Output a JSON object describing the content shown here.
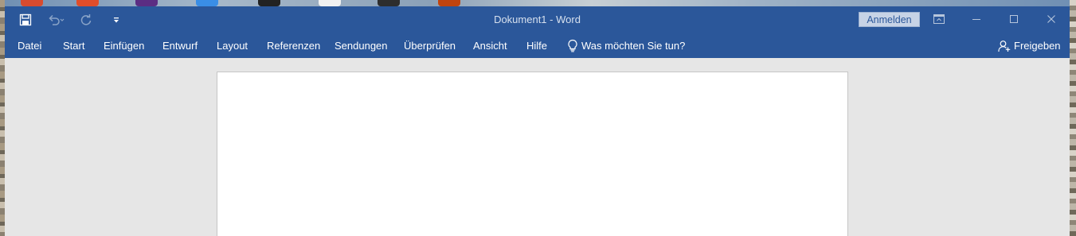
{
  "window": {
    "title": "Dokument1  -  Word"
  },
  "quick_access": {
    "save_icon": "save-icon",
    "undo_icon": "undo-icon",
    "redo_icon": "redo-icon",
    "customize_icon": "customize-qat-icon"
  },
  "account": {
    "signin_label": "Anmelden"
  },
  "menu": {
    "items": [
      {
        "label": "Datei"
      },
      {
        "label": "Start"
      },
      {
        "label": "Einfügen"
      },
      {
        "label": "Entwurf"
      },
      {
        "label": "Layout"
      },
      {
        "label": "Referenzen"
      },
      {
        "label": "Sendungen"
      },
      {
        "label": "Überprüfen"
      },
      {
        "label": "Ansicht"
      },
      {
        "label": "Hilfe"
      }
    ],
    "tell_me": "Was möchten Sie tun?",
    "share": "Freigeben"
  },
  "colors": {
    "brand": "#2b579a",
    "workspace": "#e6e6e6",
    "page": "#ffffff"
  }
}
